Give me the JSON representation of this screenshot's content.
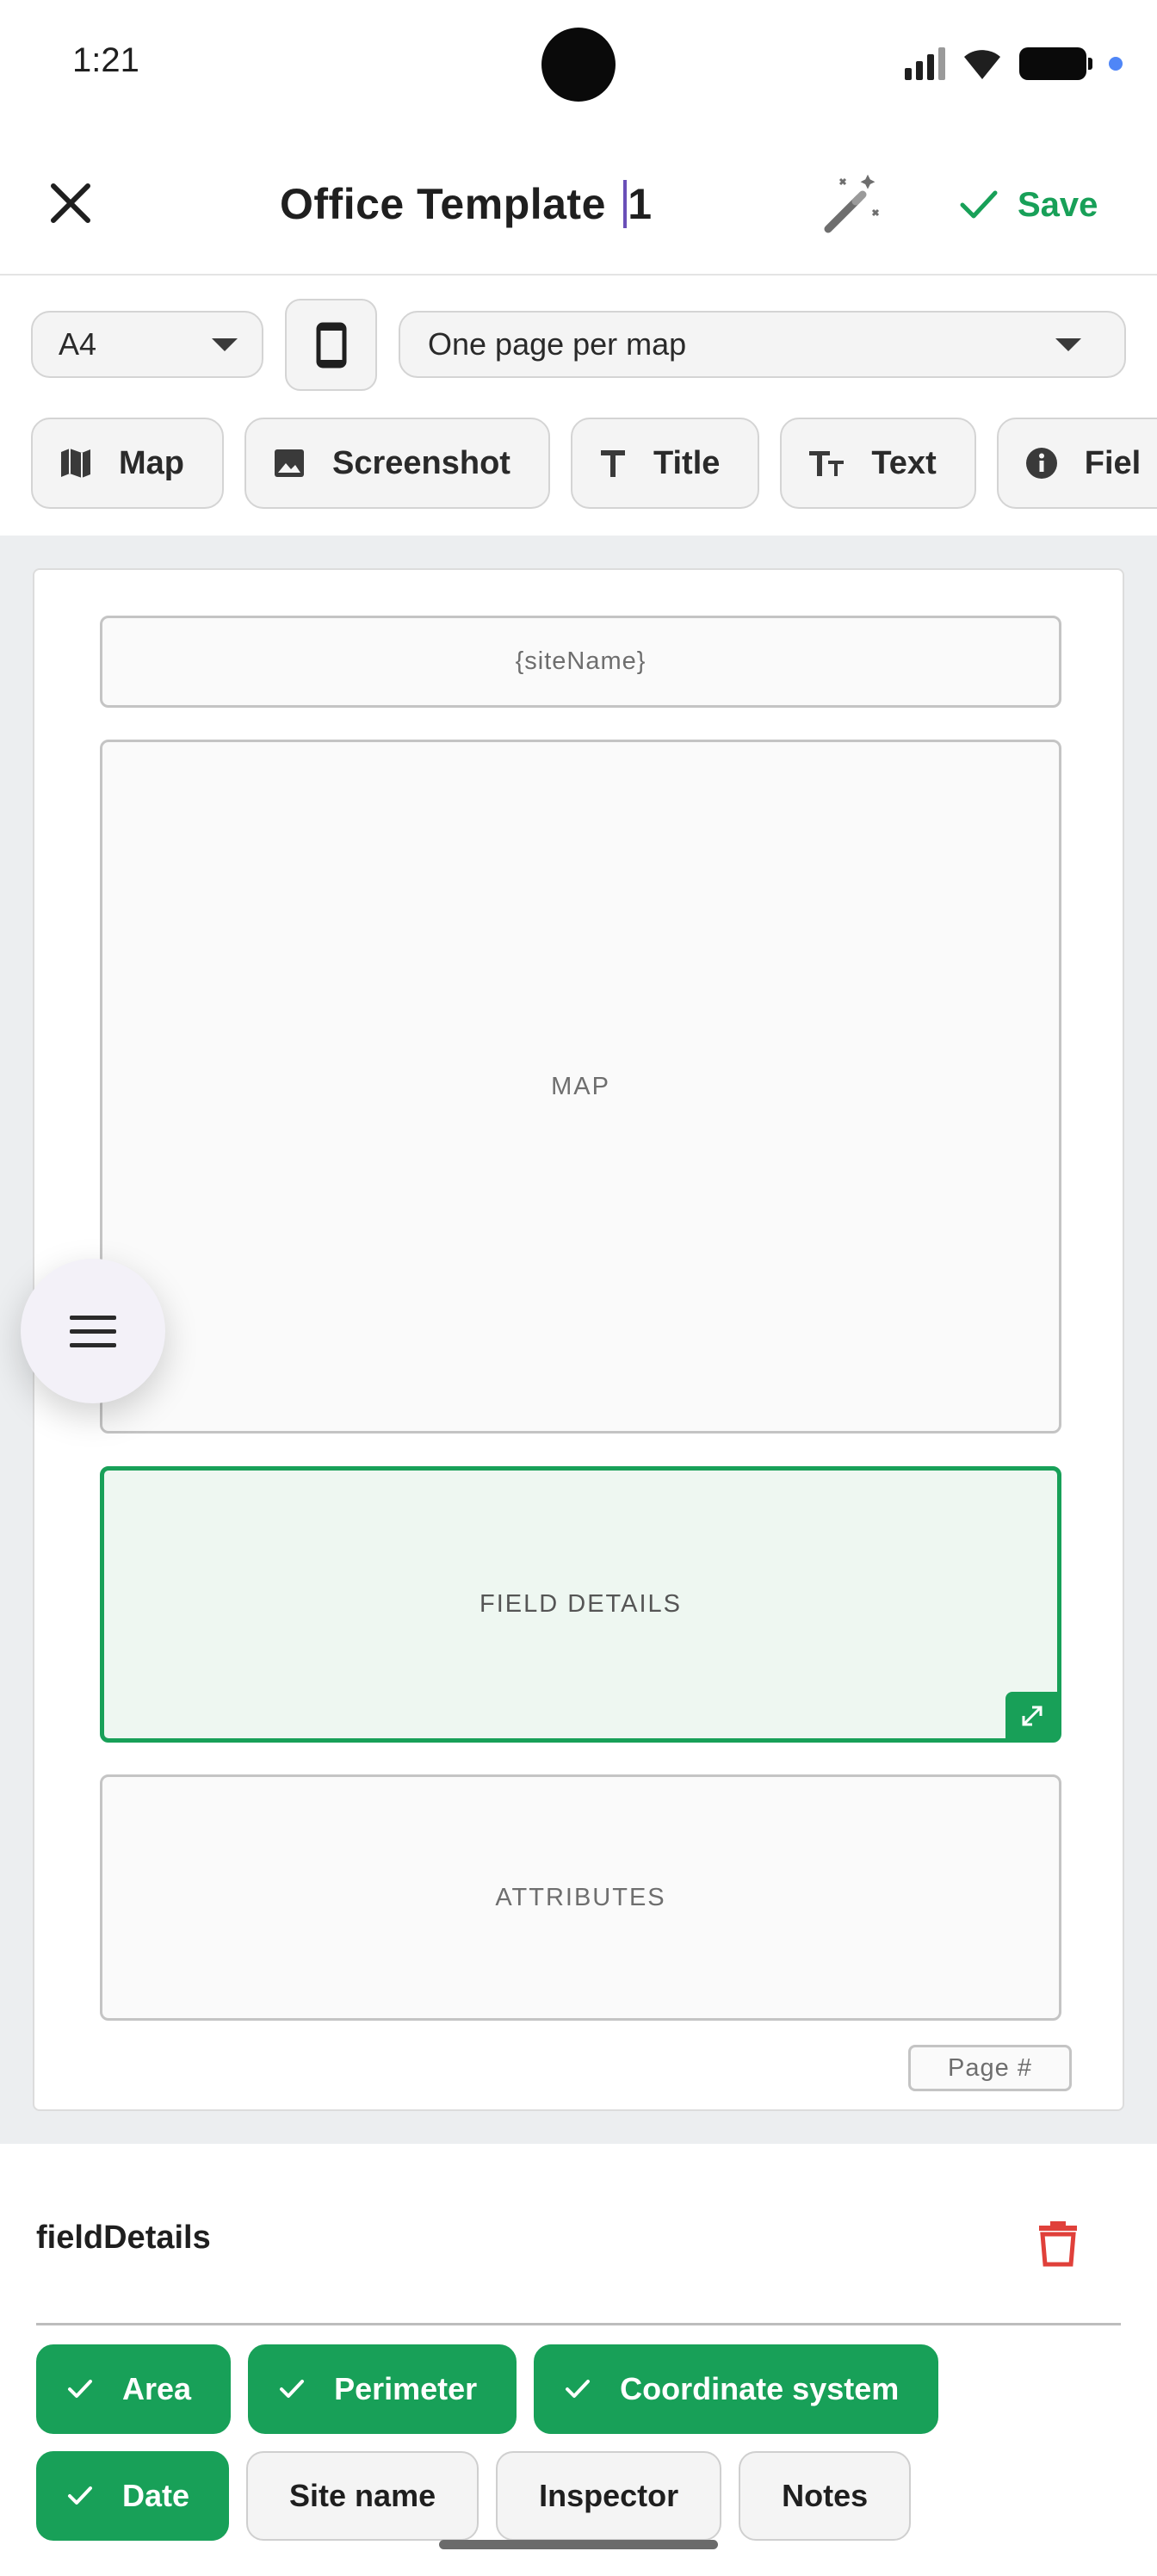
{
  "status_bar": {
    "time": "1:21"
  },
  "app_bar": {
    "close_icon": "close-icon",
    "title": "Office Template ",
    "title_after_cursor": "1",
    "magic_icon": "magic-wand-icon",
    "save_label": "Save",
    "accent_color": "#18a058"
  },
  "toolbar": {
    "page_size": "A4",
    "orientation_icon": "phone-portrait-icon",
    "layout": "One page per map",
    "elements": [
      {
        "label": "Map",
        "icon": "map-icon"
      },
      {
        "label": "Screenshot",
        "icon": "image-icon"
      },
      {
        "label": "Title",
        "icon": "title-icon"
      },
      {
        "label": "Text",
        "icon": "text-size-icon"
      },
      {
        "label": "Fiel",
        "icon": "info-icon"
      }
    ]
  },
  "canvas": {
    "blocks": {
      "site_name": "{siteName}",
      "map": "MAP",
      "field_details": "FIELD DETAILS",
      "attributes": "ATTRIBUTES"
    },
    "page_number": "Page #",
    "selected_color": "#18a058"
  },
  "panel": {
    "title": "fieldDetails",
    "delete_icon": "trash-icon",
    "delete_color": "#e0403a",
    "options": [
      {
        "label": "Area",
        "selected": true
      },
      {
        "label": "Perimeter",
        "selected": true
      },
      {
        "label": "Coordinate system",
        "selected": true
      },
      {
        "label": "Date",
        "selected": true
      },
      {
        "label": "Site name",
        "selected": false
      },
      {
        "label": "Inspector",
        "selected": false
      },
      {
        "label": "Notes",
        "selected": false
      }
    ]
  }
}
